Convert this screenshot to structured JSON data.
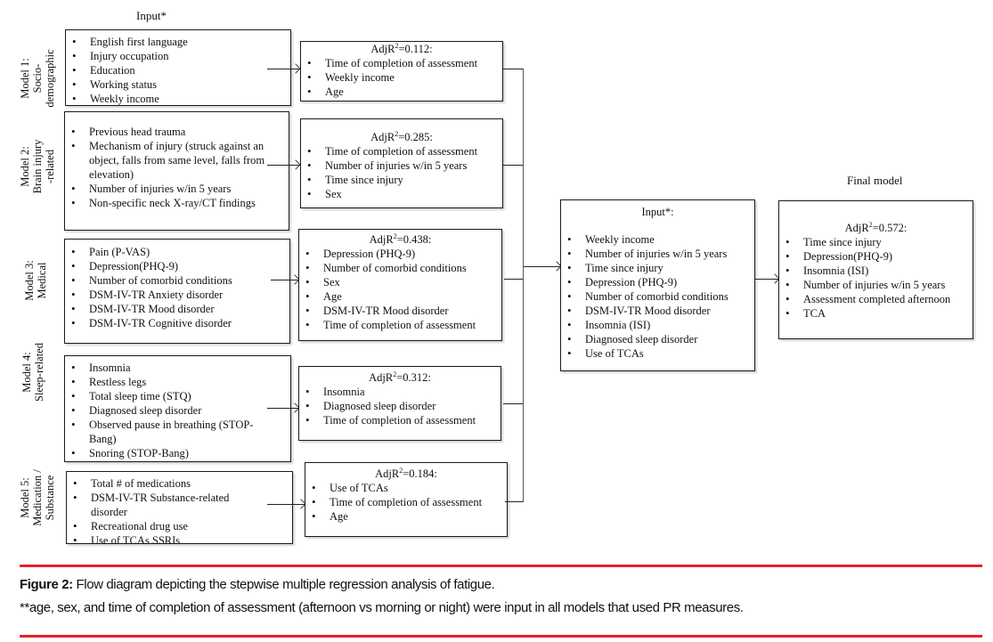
{
  "diagram": {
    "input_header": "Input*",
    "final_header": "Final model",
    "models": [
      {
        "label_lines": [
          "Model 1:",
          "Socio-",
          "demographic"
        ],
        "inputs": [
          "English first language",
          "Injury occupation",
          "Education",
          "Working status",
          "Weekly income"
        ],
        "result_title_prefix": "AdjR",
        "result_title_sup": "2",
        "result_title_value": "=0.112:",
        "results": [
          "Time of completion of assessment",
          "Weekly income",
          "Age"
        ]
      },
      {
        "label_lines": [
          "Model 2:",
          "Brain injury",
          "-related"
        ],
        "inputs": [
          "Previous head trauma",
          "Mechanism of injury (struck against an object, falls from same level, falls from elevation)",
          "Number of injuries w/in 5 years",
          "Non-specific neck X-ray/CT findings"
        ],
        "result_title_prefix": "AdjR",
        "result_title_sup": "2",
        "result_title_value": "=0.285:",
        "results": [
          "Time of completion of assessment",
          "Number of injuries w/in 5 years",
          "Time since injury",
          "Sex"
        ]
      },
      {
        "label_lines": [
          "Model 3:",
          "Medical"
        ],
        "inputs": [
          "Pain (P-VAS)",
          "Depression(PHQ-9)",
          "Number of comorbid conditions",
          "DSM-IV-TR Anxiety disorder",
          "DSM-IV-TR Mood disorder",
          "DSM-IV-TR Cognitive disorder"
        ],
        "result_title_prefix": "AdjR",
        "result_title_sup": "2",
        "result_title_value": "=0.438:",
        "results": [
          "Depression (PHQ-9)",
          "Number of comorbid conditions",
          "Sex",
          "Age",
          "DSM-IV-TR Mood disorder",
          "Time of completion of assessment"
        ]
      },
      {
        "label_lines": [
          "Model 4:",
          "Sleep-related"
        ],
        "inputs": [
          "Insomnia",
          "Restless legs",
          "Total sleep time (STQ)",
          "Diagnosed sleep disorder",
          "Observed pause in breathing (STOP-Bang)",
          "Snoring (STOP-Bang)"
        ],
        "result_title_prefix": "AdjR",
        "result_title_sup": "2",
        "result_title_value": "=0.312:",
        "results": [
          "Insomnia",
          "Diagnosed sleep disorder",
          "Time of completion of assessment"
        ]
      },
      {
        "label_lines": [
          "Model 5:",
          "Medication /",
          "Substance"
        ],
        "inputs": [
          "Total # of medications",
          "DSM-IV-TR Substance-related disorder",
          "Recreational drug use",
          "Use of TCAs SSRIs"
        ],
        "result_title_prefix": "AdjR",
        "result_title_sup": "2",
        "result_title_value": "=0.184:",
        "results": [
          "Use of TCAs",
          "Time of completion of assessment",
          "Age"
        ]
      }
    ],
    "combined_input": {
      "title": "Input*:",
      "items": [
        "Weekly income",
        "Number of injuries w/in 5 years",
        "Time since injury",
        "Depression (PHQ-9)",
        "Number of comorbid conditions",
        "DSM-IV-TR Mood disorder",
        "Insomnia (ISI)",
        "Diagnosed sleep disorder",
        "Use of TCAs"
      ]
    },
    "final_model": {
      "title_prefix": "AdjR",
      "title_sup": "2",
      "title_value": "=0.572:",
      "items": [
        "Time since injury",
        "Depression(PHQ-9)",
        "Insomnia (ISI)",
        "Number of injuries w/in 5 years",
        "Assessment completed afternoon",
        "TCA"
      ]
    }
  },
  "caption": {
    "figure_label": "Figure 2:",
    "figure_text": " Flow diagram depicting the stepwise multiple regression analysis of fatigue.",
    "footnote": "**age, sex, and time of completion of assessment (afternoon vs morning or night) were input in all models that used PR measures."
  },
  "colors": {
    "rule": "#e8202a",
    "border": "#1a1a1a"
  }
}
